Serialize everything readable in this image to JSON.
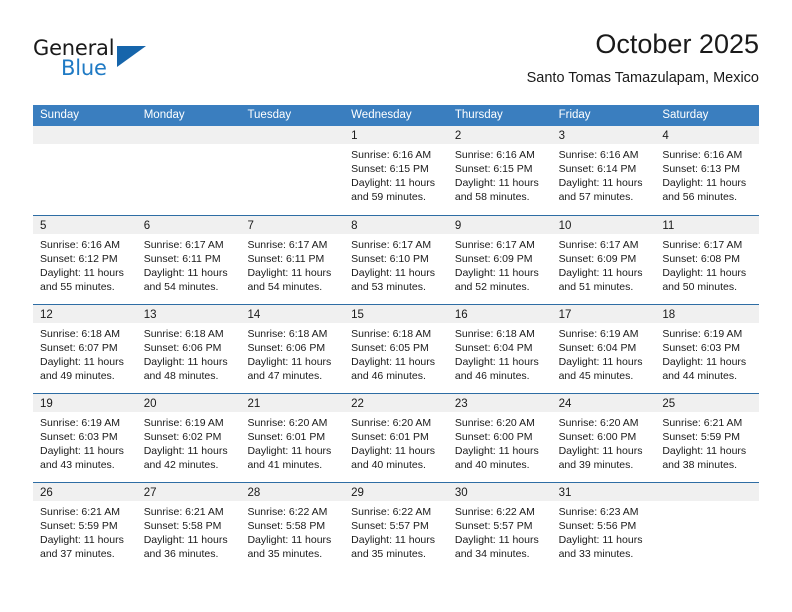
{
  "logo": {
    "word_top": "General",
    "word_bottom": "Blue",
    "triangle_icon": "triangle-icon",
    "color_dark": "#1a1a1a",
    "color_blue": "#1f7ac4",
    "triangle_color": "#1665ab"
  },
  "header": {
    "title": "October 2025",
    "subtitle": "Santo Tomas Tamazulapam, Mexico"
  },
  "colors": {
    "header_row": "#3a7ebf",
    "week_divider": "#2e6da4",
    "day_band": "#f0f0f0",
    "text": "#1a1a1a"
  },
  "weekdays": [
    "Sunday",
    "Monday",
    "Tuesday",
    "Wednesday",
    "Thursday",
    "Friday",
    "Saturday"
  ],
  "weeks": [
    [
      {
        "day": "",
        "lines": []
      },
      {
        "day": "",
        "lines": []
      },
      {
        "day": "",
        "lines": []
      },
      {
        "day": "1",
        "lines": [
          "Sunrise: 6:16 AM",
          "Sunset: 6:15 PM",
          "Daylight: 11 hours",
          "and 59 minutes."
        ]
      },
      {
        "day": "2",
        "lines": [
          "Sunrise: 6:16 AM",
          "Sunset: 6:15 PM",
          "Daylight: 11 hours",
          "and 58 minutes."
        ]
      },
      {
        "day": "3",
        "lines": [
          "Sunrise: 6:16 AM",
          "Sunset: 6:14 PM",
          "Daylight: 11 hours",
          "and 57 minutes."
        ]
      },
      {
        "day": "4",
        "lines": [
          "Sunrise: 6:16 AM",
          "Sunset: 6:13 PM",
          "Daylight: 11 hours",
          "and 56 minutes."
        ]
      }
    ],
    [
      {
        "day": "5",
        "lines": [
          "Sunrise: 6:16 AM",
          "Sunset: 6:12 PM",
          "Daylight: 11 hours",
          "and 55 minutes."
        ]
      },
      {
        "day": "6",
        "lines": [
          "Sunrise: 6:17 AM",
          "Sunset: 6:11 PM",
          "Daylight: 11 hours",
          "and 54 minutes."
        ]
      },
      {
        "day": "7",
        "lines": [
          "Sunrise: 6:17 AM",
          "Sunset: 6:11 PM",
          "Daylight: 11 hours",
          "and 54 minutes."
        ]
      },
      {
        "day": "8",
        "lines": [
          "Sunrise: 6:17 AM",
          "Sunset: 6:10 PM",
          "Daylight: 11 hours",
          "and 53 minutes."
        ]
      },
      {
        "day": "9",
        "lines": [
          "Sunrise: 6:17 AM",
          "Sunset: 6:09 PM",
          "Daylight: 11 hours",
          "and 52 minutes."
        ]
      },
      {
        "day": "10",
        "lines": [
          "Sunrise: 6:17 AM",
          "Sunset: 6:09 PM",
          "Daylight: 11 hours",
          "and 51 minutes."
        ]
      },
      {
        "day": "11",
        "lines": [
          "Sunrise: 6:17 AM",
          "Sunset: 6:08 PM",
          "Daylight: 11 hours",
          "and 50 minutes."
        ]
      }
    ],
    [
      {
        "day": "12",
        "lines": [
          "Sunrise: 6:18 AM",
          "Sunset: 6:07 PM",
          "Daylight: 11 hours",
          "and 49 minutes."
        ]
      },
      {
        "day": "13",
        "lines": [
          "Sunrise: 6:18 AM",
          "Sunset: 6:06 PM",
          "Daylight: 11 hours",
          "and 48 minutes."
        ]
      },
      {
        "day": "14",
        "lines": [
          "Sunrise: 6:18 AM",
          "Sunset: 6:06 PM",
          "Daylight: 11 hours",
          "and 47 minutes."
        ]
      },
      {
        "day": "15",
        "lines": [
          "Sunrise: 6:18 AM",
          "Sunset: 6:05 PM",
          "Daylight: 11 hours",
          "and 46 minutes."
        ]
      },
      {
        "day": "16",
        "lines": [
          "Sunrise: 6:18 AM",
          "Sunset: 6:04 PM",
          "Daylight: 11 hours",
          "and 46 minutes."
        ]
      },
      {
        "day": "17",
        "lines": [
          "Sunrise: 6:19 AM",
          "Sunset: 6:04 PM",
          "Daylight: 11 hours",
          "and 45 minutes."
        ]
      },
      {
        "day": "18",
        "lines": [
          "Sunrise: 6:19 AM",
          "Sunset: 6:03 PM",
          "Daylight: 11 hours",
          "and 44 minutes."
        ]
      }
    ],
    [
      {
        "day": "19",
        "lines": [
          "Sunrise: 6:19 AM",
          "Sunset: 6:03 PM",
          "Daylight: 11 hours",
          "and 43 minutes."
        ]
      },
      {
        "day": "20",
        "lines": [
          "Sunrise: 6:19 AM",
          "Sunset: 6:02 PM",
          "Daylight: 11 hours",
          "and 42 minutes."
        ]
      },
      {
        "day": "21",
        "lines": [
          "Sunrise: 6:20 AM",
          "Sunset: 6:01 PM",
          "Daylight: 11 hours",
          "and 41 minutes."
        ]
      },
      {
        "day": "22",
        "lines": [
          "Sunrise: 6:20 AM",
          "Sunset: 6:01 PM",
          "Daylight: 11 hours",
          "and 40 minutes."
        ]
      },
      {
        "day": "23",
        "lines": [
          "Sunrise: 6:20 AM",
          "Sunset: 6:00 PM",
          "Daylight: 11 hours",
          "and 40 minutes."
        ]
      },
      {
        "day": "24",
        "lines": [
          "Sunrise: 6:20 AM",
          "Sunset: 6:00 PM",
          "Daylight: 11 hours",
          "and 39 minutes."
        ]
      },
      {
        "day": "25",
        "lines": [
          "Sunrise: 6:21 AM",
          "Sunset: 5:59 PM",
          "Daylight: 11 hours",
          "and 38 minutes."
        ]
      }
    ],
    [
      {
        "day": "26",
        "lines": [
          "Sunrise: 6:21 AM",
          "Sunset: 5:59 PM",
          "Daylight: 11 hours",
          "and 37 minutes."
        ]
      },
      {
        "day": "27",
        "lines": [
          "Sunrise: 6:21 AM",
          "Sunset: 5:58 PM",
          "Daylight: 11 hours",
          "and 36 minutes."
        ]
      },
      {
        "day": "28",
        "lines": [
          "Sunrise: 6:22 AM",
          "Sunset: 5:58 PM",
          "Daylight: 11 hours",
          "and 35 minutes."
        ]
      },
      {
        "day": "29",
        "lines": [
          "Sunrise: 6:22 AM",
          "Sunset: 5:57 PM",
          "Daylight: 11 hours",
          "and 35 minutes."
        ]
      },
      {
        "day": "30",
        "lines": [
          "Sunrise: 6:22 AM",
          "Sunset: 5:57 PM",
          "Daylight: 11 hours",
          "and 34 minutes."
        ]
      },
      {
        "day": "31",
        "lines": [
          "Sunrise: 6:23 AM",
          "Sunset: 5:56 PM",
          "Daylight: 11 hours",
          "and 33 minutes."
        ]
      },
      {
        "day": "",
        "lines": []
      }
    ]
  ]
}
